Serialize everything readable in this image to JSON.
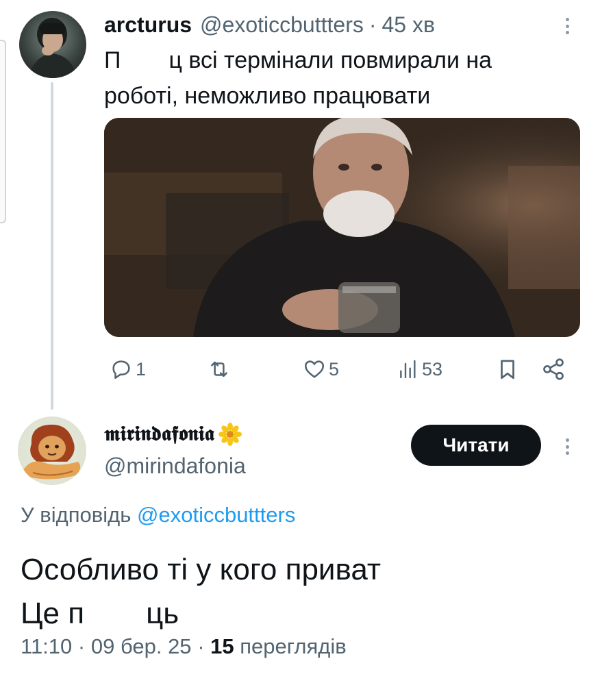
{
  "tweet1": {
    "display_name": "arcturus",
    "handle": "@exoticcbuttters",
    "separator": "·",
    "time": "45 хв",
    "text_line1_start": "П",
    "text_line1_rest": "ц всі термінали повмирали на",
    "text_line2": "роботі, неможливо працювати",
    "media_description": "video-still-old-man-with-glass",
    "actions": {
      "replies": "1",
      "reposts": "",
      "likes": "5",
      "views": "53"
    }
  },
  "tweet2": {
    "display_name": "𝖒𝖎𝖗𝖎𝖓𝖉𝖆𝖋𝖔𝖓𝖎𝖆",
    "handle": "@mirindafonia",
    "follow_label": "Читати",
    "reply_prefix": "У відповідь",
    "reply_mention": "@exoticcbuttters",
    "text_line1": "Особливо ті у кого приват",
    "text_line2_start": "Це п",
    "text_line2_end": "ць",
    "time": "11:10",
    "separator": "·",
    "date": "09 бер. 25",
    "views_count": "15",
    "views_label": "переглядів"
  },
  "colors": {
    "primary_text": "#0f1419",
    "secondary_text": "#536471",
    "link": "#1d9bf0",
    "button_bg": "#0f1419",
    "thread_line": "#cfd9de"
  },
  "icons": [
    "reply-icon",
    "repost-icon",
    "like-icon",
    "views-icon",
    "bookmark-icon",
    "share-icon",
    "more-icon",
    "flower-emoji-icon"
  ]
}
